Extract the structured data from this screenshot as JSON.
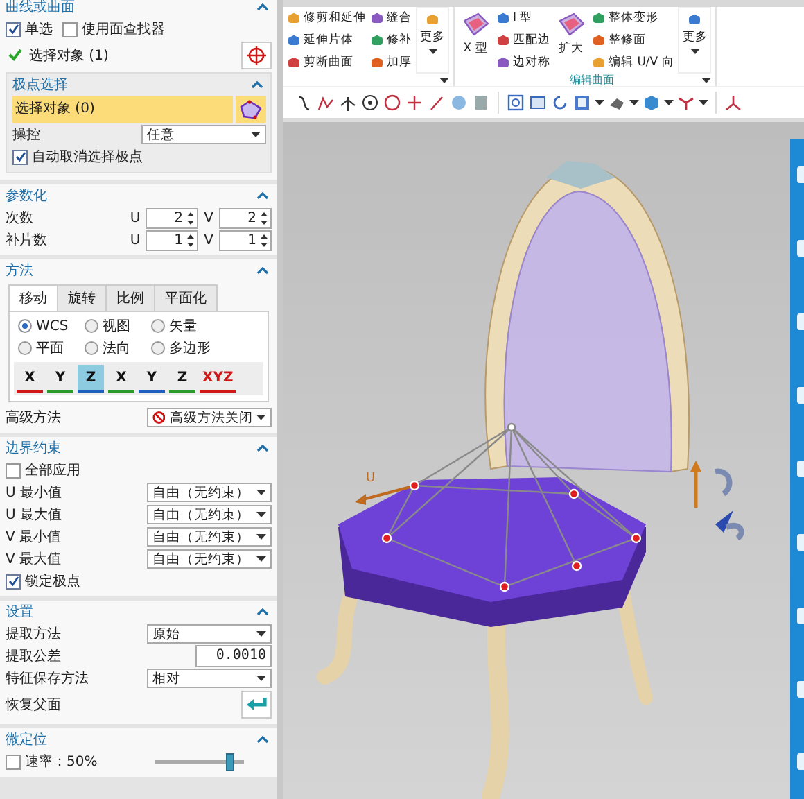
{
  "ribbon": {
    "groups": [
      {
        "blocks": [
          {
            "kind": "column",
            "items": [
              "修剪和延伸",
              "延伸片体",
              "剪断曲面"
            ]
          },
          {
            "kind": "column",
            "items": [
              "缝合",
              "修补",
              "加厚"
            ]
          },
          {
            "kind": "more",
            "label": "更多"
          }
        ]
      },
      {
        "label": "编辑曲面",
        "blocks": [
          {
            "kind": "big",
            "label": "X 型"
          },
          {
            "kind": "column",
            "items": [
              "I 型",
              "匹配边",
              "边对称"
            ]
          },
          {
            "kind": "big",
            "label": "扩大"
          },
          {
            "kind": "column",
            "items": [
              "整体变形",
              "整修面",
              "编辑 U/V 向"
            ]
          },
          {
            "kind": "more",
            "label": "更多"
          }
        ]
      }
    ]
  },
  "panel": {
    "sections": [
      {
        "title": "曲线或曲面",
        "rows": [
          {
            "kind": "checks",
            "items": [
              {
                "label": "单选",
                "checked": true
              },
              {
                "label": "使用面查找器",
                "checked": false
              }
            ]
          },
          {
            "kind": "selection",
            "label": "选择对象 (1)",
            "done": true
          },
          {
            "kind": "group",
            "title": "极点选择",
            "rows": [
              {
                "kind": "pole_selection",
                "label": "选择对象 (0)",
                "active": true
              },
              {
                "kind": "dropdown",
                "label": "操控",
                "value": "任意"
              },
              {
                "kind": "checks",
                "items": [
                  {
                    "label": "自动取消选择极点",
                    "checked": true
                  }
                ]
              }
            ]
          }
        ]
      },
      {
        "title": "参数化",
        "rows": [
          {
            "kind": "spinners",
            "label": "次数",
            "fields": [
              {
                "axis": "U",
                "value": "2"
              },
              {
                "axis": "V",
                "value": "2"
              }
            ]
          },
          {
            "kind": "spinners",
            "label": "补片数",
            "fields": [
              {
                "axis": "U",
                "value": "1"
              },
              {
                "axis": "V",
                "value": "1"
              }
            ]
          }
        ]
      },
      {
        "title": "方法",
        "rows": [
          {
            "kind": "tabbox",
            "tabs": [
              {
                "label": "移动",
                "selected": true
              },
              {
                "label": "旋转",
                "selected": false
              },
              {
                "label": "比例",
                "selected": false
              },
              {
                "label": "平面化",
                "selected": false
              }
            ],
            "radios": [
              {
                "label": "WCS",
                "selected": true
              },
              {
                "label": "视图",
                "selected": false
              },
              {
                "label": "矢量",
                "selected": false
              },
              {
                "label": "平面",
                "selected": false
              },
              {
                "label": "法向",
                "selected": false
              },
              {
                "label": "多边形",
                "selected": false
              }
            ],
            "axes": [
              {
                "label": "X",
                "selected": false
              },
              {
                "label": "Y",
                "selected": false
              },
              {
                "label": "Z",
                "selected": true
              },
              {
                "label": "X",
                "selected": false
              },
              {
                "label": "Y",
                "selected": false
              },
              {
                "label": "Z",
                "selected": false
              },
              {
                "label": "XYZ",
                "selected": false
              }
            ]
          },
          {
            "kind": "dropdown",
            "label": "高级方法",
            "value": "高级方法关闭",
            "disabled_icon": true
          }
        ]
      },
      {
        "title": "边界约束",
        "rows": [
          {
            "kind": "checks",
            "items": [
              {
                "label": "全部应用",
                "checked": false
              }
            ]
          },
          {
            "kind": "dropdown",
            "label": "U 最小值",
            "value": "自由（无约束）"
          },
          {
            "kind": "dropdown",
            "label": "U 最大值",
            "value": "自由（无约束）"
          },
          {
            "kind": "dropdown",
            "label": "V 最小值",
            "value": "自由（无约束）"
          },
          {
            "kind": "dropdown",
            "label": "V 最大值",
            "value": "自由（无约束）"
          },
          {
            "kind": "checks",
            "items": [
              {
                "label": "锁定极点",
                "checked": true
              }
            ]
          }
        ]
      },
      {
        "title": "设置",
        "rows": [
          {
            "kind": "dropdown",
            "label": "提取方法",
            "value": "原始"
          },
          {
            "kind": "number",
            "label": "提取公差",
            "value": "0.0010"
          },
          {
            "kind": "dropdown",
            "label": "特征保存方法",
            "value": "相对"
          },
          {
            "kind": "button",
            "label": "恢复父面"
          }
        ]
      },
      {
        "title": "微定位",
        "rows": [
          {
            "kind": "slider",
            "label": "速率：50%",
            "checked": false,
            "level": 0.85
          }
        ]
      }
    ]
  },
  "viewport": {
    "axis_label": "U"
  }
}
